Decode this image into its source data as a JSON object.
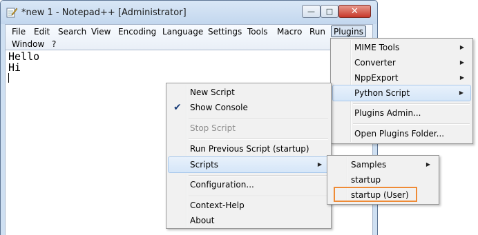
{
  "window": {
    "title": "*new 1 - Notepad++ [Administrator]"
  },
  "caption_buttons": {
    "minimize": "—",
    "maximize": "□",
    "close": "✕"
  },
  "menubar": {
    "items": [
      "File",
      "Edit",
      "Search",
      "View",
      "Encoding",
      "Language",
      "Settings",
      "Tools",
      "Macro",
      "Run",
      "Plugins",
      "Window",
      "?"
    ]
  },
  "editor": {
    "lines": [
      "Hello",
      "Hi"
    ]
  },
  "plugins_menu": {
    "items": [
      {
        "label": "MIME Tools",
        "submenu": true
      },
      {
        "label": "Converter",
        "submenu": true
      },
      {
        "label": "NppExport",
        "submenu": true
      },
      {
        "label": "Python Script",
        "submenu": true,
        "highlighted": true
      },
      {
        "label": "Plugins Admin..."
      },
      {
        "label": "Open Plugins Folder..."
      }
    ]
  },
  "python_script_menu": {
    "items": [
      {
        "label": "New Script"
      },
      {
        "label": "Show Console",
        "checked": true
      },
      {
        "label": "Stop Script",
        "disabled": true
      },
      {
        "label": "Run Previous Script (startup)"
      },
      {
        "label": "Scripts",
        "submenu": true,
        "highlighted": true
      },
      {
        "label": "Configuration..."
      },
      {
        "label": "Context-Help"
      },
      {
        "label": "About"
      }
    ]
  },
  "scripts_submenu": {
    "items": [
      {
        "label": "Samples",
        "submenu": true
      },
      {
        "label": "startup"
      },
      {
        "label": "startup (User)",
        "annotated": true
      }
    ]
  },
  "colors": {
    "annotation_outline": "#ef8b36",
    "highlight": "#d5e6f8"
  }
}
